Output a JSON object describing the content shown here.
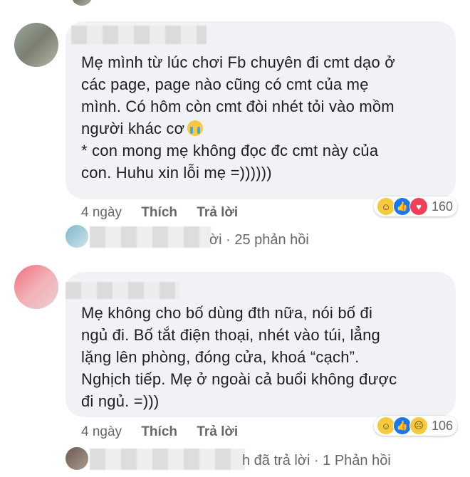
{
  "comments": [
    {
      "lines": [
        "Mẹ mình từ lúc chơi Fb chuyên đi cmt dạo ở",
        "các page, page nào cũng có cmt của mẹ",
        "mình. Có hôm còn cmt đòi nhét tỏi vào mồm",
        "người khác cơ",
        "* con mong mẹ không đọc đc cmt này của",
        "con. Huhu xin lỗi mẹ =))))))"
      ],
      "time": "4 ngày",
      "like": "Thích",
      "reply": "Trả lời",
      "reaction_count": "160",
      "reactions": [
        "haha-icon",
        "like-icon",
        "love-icon"
      ],
      "replies_text": "ời · 25 phản hồi"
    },
    {
      "lines": [
        "Mẹ không cho bố dùng đth nữa, nói bố đi",
        "ngủ đi. Bố tắt điện thoại, nhét vào túi, lẳng",
        "lặng lên phòng, đóng cửa, khoá “cạch”.",
        "Nghịch tiếp. Mẹ ở ngoài cả buổi không được",
        "đi ngủ. =)))"
      ],
      "time": "4 ngày",
      "like": "Thích",
      "reply": "Trả lời",
      "reaction_count": "106",
      "reactions": [
        "haha-icon",
        "like-icon",
        "sad-icon"
      ],
      "replies_text": "h đã trả lời · 1 Phản hồi"
    }
  ]
}
